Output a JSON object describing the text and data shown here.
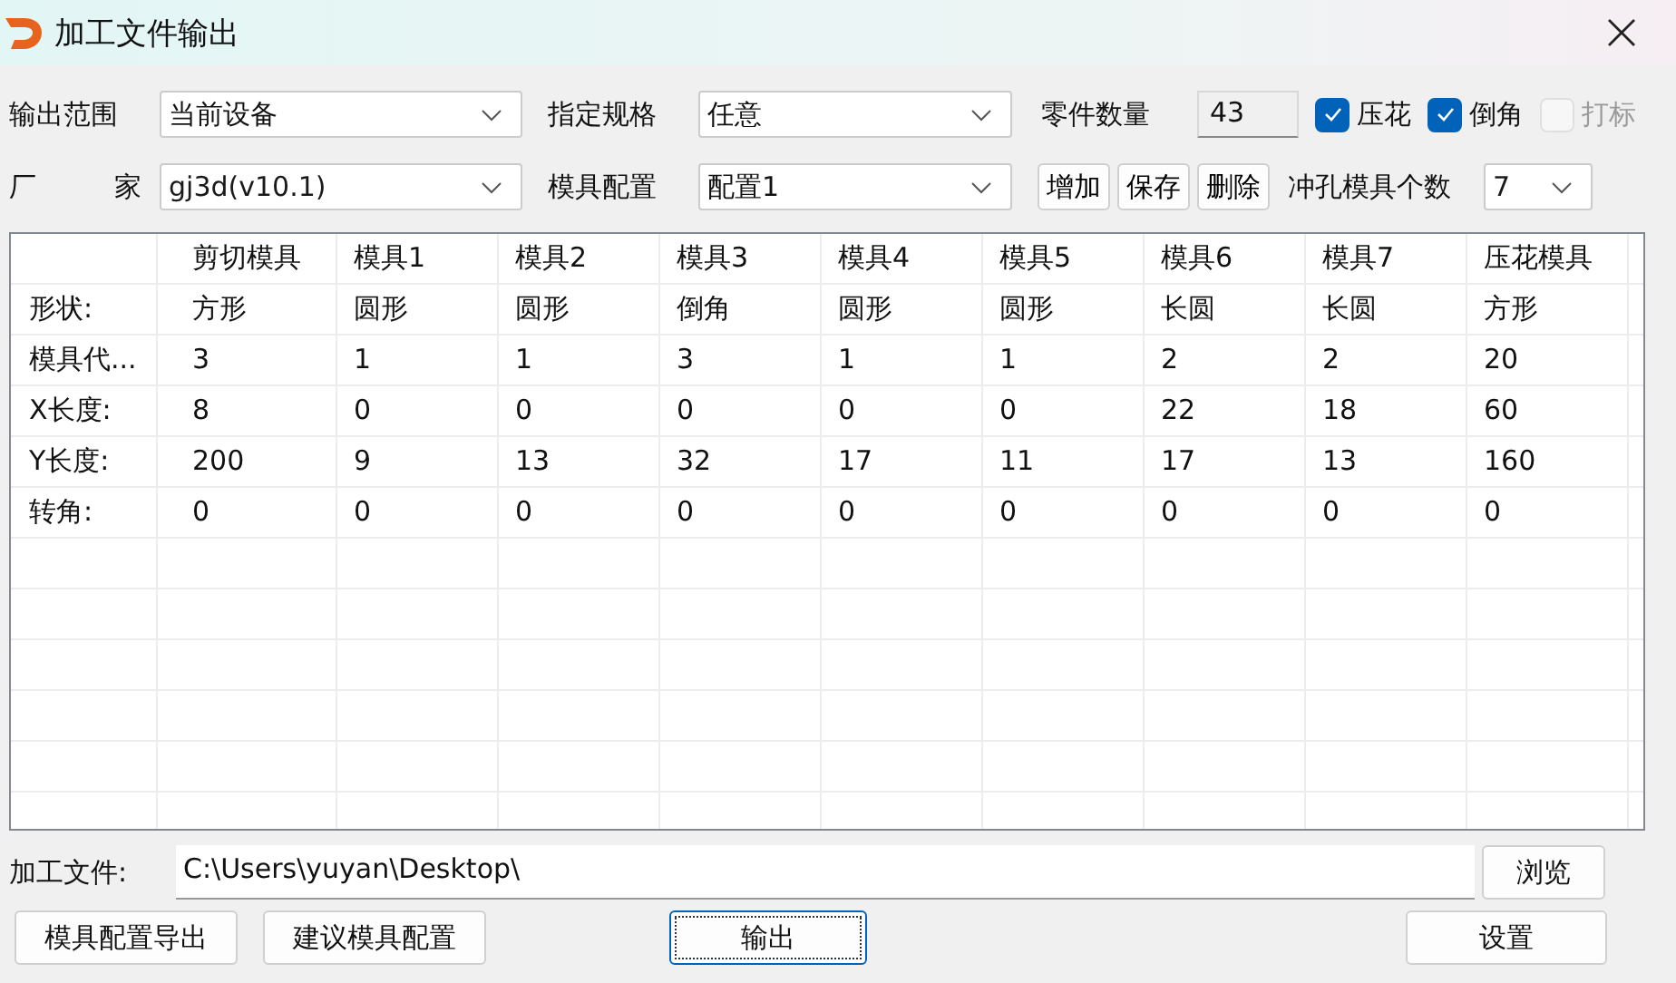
{
  "window": {
    "title": "加工文件输出"
  },
  "row1": {
    "range_label": "输出范围",
    "range_value": "当前设备",
    "spec_label": "指定规格",
    "spec_value": "任意",
    "count_label": "零件数量",
    "count_value": "43",
    "checks": [
      {
        "label": "压花",
        "checked": true,
        "disabled": false
      },
      {
        "label": "倒角",
        "checked": true,
        "disabled": false
      },
      {
        "label": "打标",
        "checked": false,
        "disabled": true
      }
    ]
  },
  "row2": {
    "maker_label": [
      "厂",
      "家"
    ],
    "maker_value": "gj3d(v10.1)",
    "config_label": "模具配置",
    "config_value": "配置1",
    "buttons": [
      "增加",
      "保存",
      "删除"
    ],
    "punch_label": "冲孔模具个数",
    "punch_value": "7"
  },
  "table": {
    "columns": [
      "剪切模具",
      "模具1",
      "模具2",
      "模具3",
      "模具4",
      "模具5",
      "模具6",
      "模具7",
      "压花模具"
    ],
    "rows": [
      {
        "label": "形状:",
        "cells": [
          "方形",
          "圆形",
          "圆形",
          "倒角",
          "圆形",
          "圆形",
          "长圆",
          "长圆",
          "方形"
        ]
      },
      {
        "label": "模具代...",
        "cells": [
          "3",
          "1",
          "1",
          "3",
          "1",
          "1",
          "2",
          "2",
          "20"
        ]
      },
      {
        "label": "X长度:",
        "cells": [
          "8",
          "0",
          "0",
          "0",
          "0",
          "0",
          "22",
          "18",
          "60"
        ]
      },
      {
        "label": "Y长度:",
        "cells": [
          "200",
          "9",
          "13",
          "32",
          "17",
          "11",
          "17",
          "13",
          "160"
        ]
      },
      {
        "label": "转角:",
        "cells": [
          "0",
          "0",
          "0",
          "0",
          "0",
          "0",
          "0",
          "0",
          "0"
        ]
      }
    ]
  },
  "file": {
    "label": "加工文件:",
    "value": "C:\\Users\\yuyan\\Desktop\\",
    "browse": "浏览"
  },
  "bottom_buttons": [
    {
      "label": "模具配置导出",
      "focused": false
    },
    {
      "label": "建议模具配置",
      "focused": false
    },
    {
      "label": "输出",
      "focused": true
    },
    {
      "label": "设置",
      "focused": false
    }
  ]
}
